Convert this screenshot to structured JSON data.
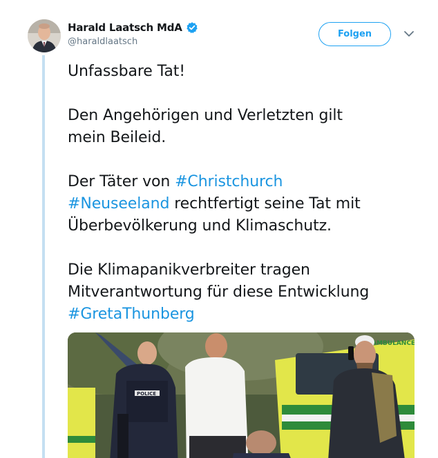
{
  "author": {
    "display_name": "Harald Laatsch MdA",
    "handle": "@haraldlaatsch",
    "verified_icon": "verified-badge-icon"
  },
  "actions": {
    "follow_label": "Folgen",
    "menu_icon": "chevron-down-icon"
  },
  "tweet": {
    "p1": "Unfassbare Tat!",
    "p2_line1": "Den Angehörigen und Verletzten gilt",
    "p2_line2": "mein Beileid.",
    "p3_prefix": "Der Täter von ",
    "p3_tag1": "#Christchurch",
    "p3_tag2": "#Neuseeland",
    "p3_rest1": " rechtfertigt seine Tat mit",
    "p3_line3": "Überbevölkerung und Klimaschutz.",
    "p4_line1": "Die Klimapanikverbreiter tragen",
    "p4_line2": "Mitverantwortung für diese Entwicklung",
    "p4_tag": "#GretaThunberg"
  },
  "media": {
    "ambulance_text": "AMBULANCE",
    "police_text": "POLICE"
  },
  "colors": {
    "link": "#1b95e0",
    "follow_accent": "#1da1f2",
    "thread_line": "#c4dff2",
    "handle_gray": "#657786"
  }
}
